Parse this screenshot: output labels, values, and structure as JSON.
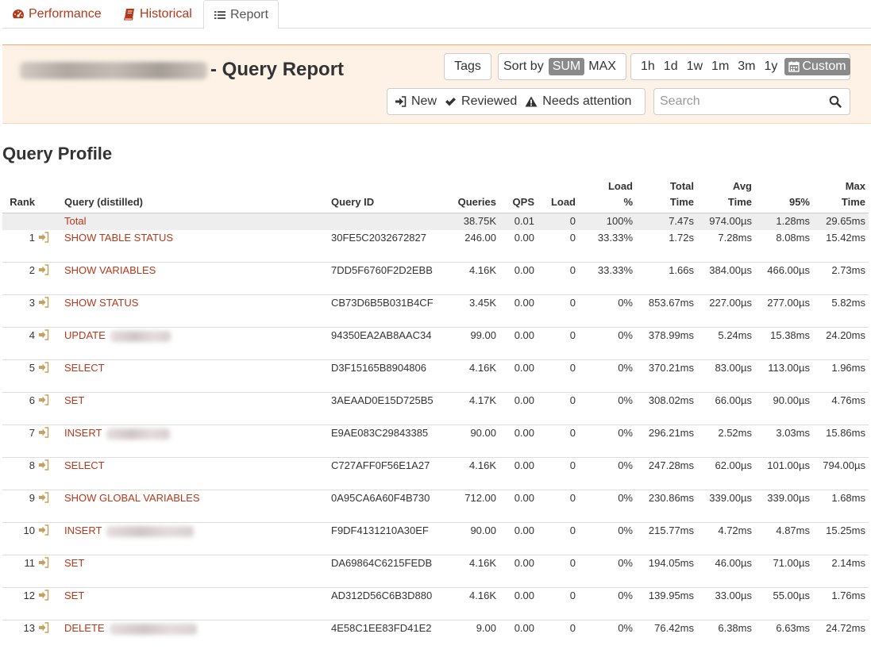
{
  "tabs": [
    {
      "label": "Performance",
      "icon": "dashboard-icon"
    },
    {
      "label": "Historical",
      "icon": "book-icon"
    },
    {
      "label": "Report",
      "icon": "list-icon"
    }
  ],
  "header": {
    "title": "- Query Report",
    "tags_label": "Tags",
    "sort": {
      "label": "Sort by",
      "options": [
        "SUM",
        "MAX"
      ],
      "active": "SUM"
    },
    "ranges": [
      "1h",
      "1d",
      "1w",
      "1m",
      "3m",
      "1y"
    ],
    "custom_label": "Custom",
    "status_filters": [
      {
        "label": "New",
        "icon": "sign-in-icon"
      },
      {
        "label": "Reviewed",
        "icon": "check-icon"
      },
      {
        "label": "Needs attention",
        "icon": "warning-icon"
      }
    ],
    "search_placeholder": "Search"
  },
  "section_title": "Query Profile",
  "table": {
    "columns": {
      "rank": "Rank",
      "query": "Query (distilled)",
      "query_id": "Query ID",
      "queries": "Queries",
      "qps": "QPS",
      "load": "Load",
      "load_pct_1": "Load",
      "load_pct_2": "%",
      "total_time_1": "Total",
      "total_time_2": "Time",
      "avg_time_1": "Avg",
      "avg_time_2": "Time",
      "p95": "95%",
      "max_time_1": "Max",
      "max_time_2": "Time"
    },
    "total": {
      "label": "Total",
      "queries": "38.75K",
      "qps": "0.01",
      "load": "0",
      "load_pct": "100%",
      "total_time": "7.47s",
      "avg_time": "974.00µs",
      "p95": "1.28ms",
      "max_time": "29.65ms"
    },
    "rows": [
      {
        "rank": "1",
        "query": "SHOW TABLE STATUS",
        "query_id": "30FE5C2032672827",
        "queries": "246.00",
        "qps": "0.00",
        "load": "0",
        "load_pct": "33.33%",
        "total_time": "1.72s",
        "avg_time": "7.28ms",
        "p95": "8.08ms",
        "max_time": "15.42ms"
      },
      {
        "rank": "2",
        "query": "SHOW VARIABLES",
        "query_id": "7DD5F6760F2D2EBB",
        "queries": "4.16K",
        "qps": "0.00",
        "load": "0",
        "load_pct": "33.33%",
        "total_time": "1.66s",
        "avg_time": "384.00µs",
        "p95": "466.00µs",
        "max_time": "2.73ms"
      },
      {
        "rank": "3",
        "query": "SHOW STATUS",
        "query_id": "CB73D6B5B031B4CF",
        "queries": "3.45K",
        "qps": "0.00",
        "load": "0",
        "load_pct": "0%",
        "total_time": "853.67ms",
        "avg_time": "227.00µs",
        "p95": "277.00µs",
        "max_time": "5.82ms"
      },
      {
        "rank": "4",
        "query": "UPDATE",
        "query_id": "94350EA2AB8AAC34",
        "queries": "99.00",
        "qps": "0.00",
        "load": "0",
        "load_pct": "0%",
        "total_time": "378.99ms",
        "avg_time": "5.24ms",
        "p95": "15.38ms",
        "max_time": "24.20ms"
      },
      {
        "rank": "5",
        "query": "SELECT",
        "query_id": "D3F15165B8904806",
        "queries": "4.16K",
        "qps": "0.00",
        "load": "0",
        "load_pct": "0%",
        "total_time": "370.21ms",
        "avg_time": "83.00µs",
        "p95": "113.00µs",
        "max_time": "1.96ms"
      },
      {
        "rank": "6",
        "query": "SET",
        "query_id": "3AEAAD0E15D725B5",
        "queries": "4.17K",
        "qps": "0.00",
        "load": "0",
        "load_pct": "0%",
        "total_time": "308.02ms",
        "avg_time": "66.00µs",
        "p95": "90.00µs",
        "max_time": "4.76ms"
      },
      {
        "rank": "7",
        "query": "INSERT",
        "query_id": "E9AE083C29843385",
        "queries": "90.00",
        "qps": "0.00",
        "load": "0",
        "load_pct": "0%",
        "total_time": "296.21ms",
        "avg_time": "2.52ms",
        "p95": "3.03ms",
        "max_time": "15.86ms"
      },
      {
        "rank": "8",
        "query": "SELECT",
        "query_id": "C727AFF0F56E1A27",
        "queries": "4.16K",
        "qps": "0.00",
        "load": "0",
        "load_pct": "0%",
        "total_time": "247.28ms",
        "avg_time": "62.00µs",
        "p95": "101.00µs",
        "max_time": "794.00µs"
      },
      {
        "rank": "9",
        "query": "SHOW GLOBAL VARIABLES",
        "query_id": "0A95CA6A60F4B730",
        "queries": "712.00",
        "qps": "0.00",
        "load": "0",
        "load_pct": "0%",
        "total_time": "230.86ms",
        "avg_time": "339.00µs",
        "p95": "339.00µs",
        "max_time": "1.68ms"
      },
      {
        "rank": "10",
        "query": "INSERT",
        "query_id": "F9DF4131210A30EF",
        "queries": "90.00",
        "qps": "0.00",
        "load": "0",
        "load_pct": "0%",
        "total_time": "215.77ms",
        "avg_time": "4.72ms",
        "p95": "4.87ms",
        "max_time": "15.25ms"
      },
      {
        "rank": "11",
        "query": "SET",
        "query_id": "DA69864C6215FEDB",
        "queries": "4.16K",
        "qps": "0.00",
        "load": "0",
        "load_pct": "0%",
        "total_time": "194.05ms",
        "avg_time": "46.00µs",
        "p95": "71.00µs",
        "max_time": "2.14ms"
      },
      {
        "rank": "12",
        "query": "SET",
        "query_id": "AD312D56C6B3D880",
        "queries": "4.16K",
        "qps": "0.00",
        "load": "0",
        "load_pct": "0%",
        "total_time": "139.95ms",
        "avg_time": "33.00µs",
        "p95": "55.00µs",
        "max_time": "1.76ms"
      },
      {
        "rank": "13",
        "query": "DELETE",
        "query_id": "4E58C1EE83FD41E2",
        "queries": "9.00",
        "qps": "0.00",
        "load": "0",
        "load_pct": "0%",
        "total_time": "76.42ms",
        "avg_time": "6.38ms",
        "p95": "6.63ms",
        "max_time": "24.72ms"
      }
    ]
  },
  "colors": {
    "accent": "#b5381b",
    "panel_bg": "#fdf2e5",
    "active_btn": "#8a8a8a",
    "row_icon": "#c8a060"
  }
}
